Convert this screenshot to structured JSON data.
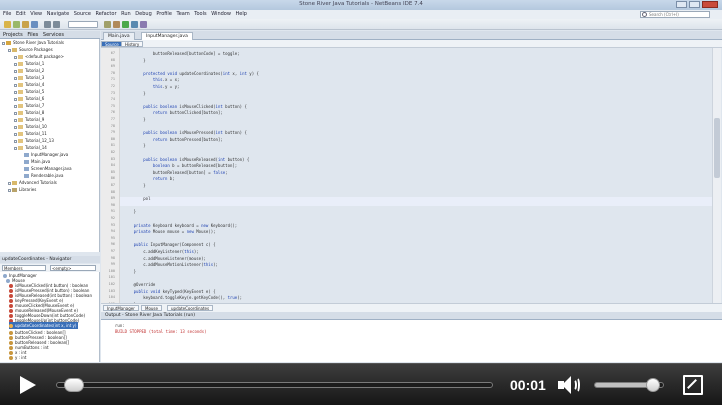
{
  "window": {
    "title": "Stone River Java Tutorials - NetBeans IDE 7.4"
  },
  "menu": [
    "File",
    "Edit",
    "View",
    "Navigate",
    "Source",
    "Refactor",
    "Run",
    "Debug",
    "Profile",
    "Team",
    "Tools",
    "Window",
    "Help"
  ],
  "search": {
    "placeholder": "Search (Ctrl+I)"
  },
  "projects": {
    "tabs": [
      "Projects",
      "Files",
      "Services"
    ],
    "tree": [
      {
        "label": "Stone River Java Tutorials",
        "level": 0
      },
      {
        "label": "Source Packages",
        "level": 1
      },
      {
        "label": "<default package>",
        "level": 2
      },
      {
        "label": "Tutorial_1",
        "level": 2
      },
      {
        "label": "Tutorial_2",
        "level": 2
      },
      {
        "label": "Tutorial_3",
        "level": 2
      },
      {
        "label": "Tutorial_4",
        "level": 2
      },
      {
        "label": "Tutorial_5",
        "level": 2
      },
      {
        "label": "Tutorial_6",
        "level": 2
      },
      {
        "label": "Tutorial_7",
        "level": 2
      },
      {
        "label": "Tutorial_8",
        "level": 2
      },
      {
        "label": "Tutorial_9",
        "level": 2
      },
      {
        "label": "Tutorial_10",
        "level": 2
      },
      {
        "label": "Tutorial_11",
        "level": 2
      },
      {
        "label": "Tutorial_12_13",
        "level": 2
      },
      {
        "label": "Tutorial_14",
        "level": 2
      },
      {
        "label": "InputManager.java",
        "level": 3
      },
      {
        "label": "Main.java",
        "level": 3
      },
      {
        "label": "ScreenManager.java",
        "level": 3
      },
      {
        "label": "Renderable.java",
        "level": 3
      },
      {
        "label": "Advanced Tutorials",
        "level": 1
      },
      {
        "label": "Libraries",
        "level": 1
      }
    ]
  },
  "navigator": {
    "title": "updateCoordinates - Navigator",
    "selects": [
      "Members",
      "<empty>"
    ],
    "items": [
      "InputManager",
      "Mouse",
      "isMouseClicked(int button) : boolean",
      "isMousePressed(int button) : boolean",
      "isMouseReleased(int button) : boolean",
      "keyPressed(KeyEvent e)",
      "mouseClicked(MouseEvent e)",
      "mouseReleased(MouseEvent e)",
      "toggleMouseDown(int buttonCode)",
      "toggleMouseUp(int buttonCode)",
      "updateCoordinates(int x, int y)",
      "buttonClicked : boolean[]",
      "buttonPressed : boolean[]",
      "buttonReleased : boolean[]",
      "numButtons : int",
      "x : int",
      "y : int"
    ]
  },
  "editor": {
    "tabs": [
      "Main.java",
      "InputManager.java"
    ],
    "views": [
      "Source",
      "History"
    ],
    "line_numbers": [
      "67",
      "68",
      "69",
      "70",
      "71",
      "72",
      "73",
      "74",
      "75",
      "76",
      "77",
      "78",
      "79",
      "80",
      "81",
      "82",
      "83",
      "84",
      "85",
      "86",
      "87",
      "88",
      "89",
      "90",
      "91",
      "92",
      "93",
      "94",
      "95",
      "96",
      "97",
      "98",
      "99",
      "100",
      "101",
      "102",
      "103",
      "104",
      "105"
    ],
    "lines": [
      "            buttonReleased[buttonCode] = toggle;",
      "        }",
      "",
      "        protected void updateCoordinates(int x, int y) {",
      "            this.x = x;",
      "            this.y = y;",
      "        }",
      "",
      "        public boolean isMouseClicked(int button) {",
      "            return buttonClicked[button];",
      "        }",
      "",
      "        public boolean isMousePressed(int button) {",
      "            return buttonPressed[button];",
      "        }",
      "",
      "        public boolean isMouseReleased(int button) {",
      "            boolean b = buttonReleased[button];",
      "            buttonReleased[button] = false;",
      "            return b;",
      "        }",
      "",
      "        pol",
      "",
      "    }",
      "",
      "    private Keyboard keyboard = new Keyboard();",
      "    private Mouse mouse = new Mouse();",
      "",
      "    public InputManager(Component c) {",
      "        c.addKeyListener(this);",
      "        c.addMouseListener(mouse);",
      "        c.addMouseMotionListener(this);",
      "    }",
      "",
      "    @Override",
      "    public void keyTyped(KeyEvent e) {",
      "        keyboard.toggleKey(e.getKeyCode(), true);",
      "    }"
    ]
  },
  "breadcrumbs": [
    "InputManager",
    "Mouse",
    "updateCoordinates"
  ],
  "output": {
    "title": "Output - Stone River Java Tutorials (run)",
    "lines": [
      "run:",
      "BUILD STOPPED (total time: 13 seconds)"
    ]
  },
  "player": {
    "time": "00:01",
    "progress": 0.02,
    "volume": 0.85
  }
}
